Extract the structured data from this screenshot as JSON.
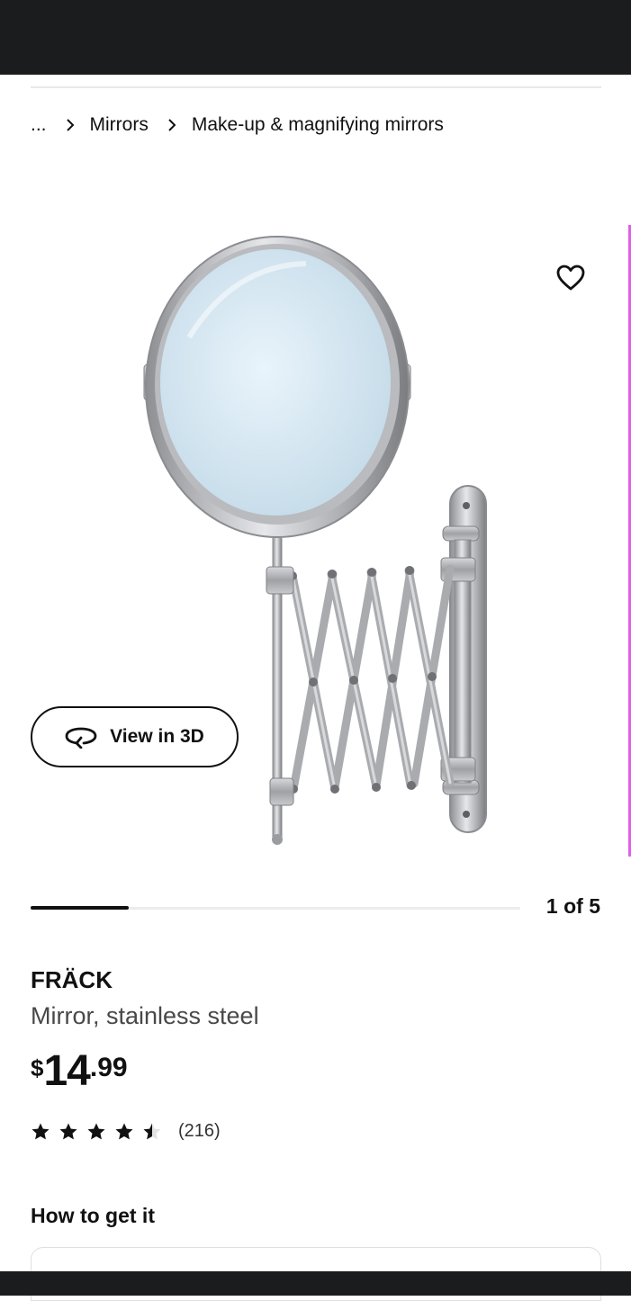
{
  "breadcrumb": {
    "items": [
      "...",
      "Mirrors",
      "Make-up & magnifying mirrors"
    ]
  },
  "gallery": {
    "image_alt": "FRÄCK mirror",
    "view_3d_label": "View in 3D",
    "counter": "1 of 5",
    "progress": 0.2
  },
  "product": {
    "name": "FRÄCK",
    "description": "Mirror, stainless steel",
    "price": {
      "currency": "$",
      "integer": "14",
      "decimal": ".99"
    },
    "rating": {
      "value": 4.5,
      "max": 5,
      "review_count": "(216)"
    }
  },
  "sections": {
    "how_to_get_it": "How to get it"
  },
  "icons": {
    "favorite": "heart-icon",
    "view_3d": "rotate-3d-icon",
    "breadcrumb_separator": "chevron-right-icon"
  },
  "colors": {
    "status_bar": "#1b1c1e",
    "text": "#111111",
    "secondary_text": "#484848",
    "gallery_edge": "#e060e6"
  }
}
